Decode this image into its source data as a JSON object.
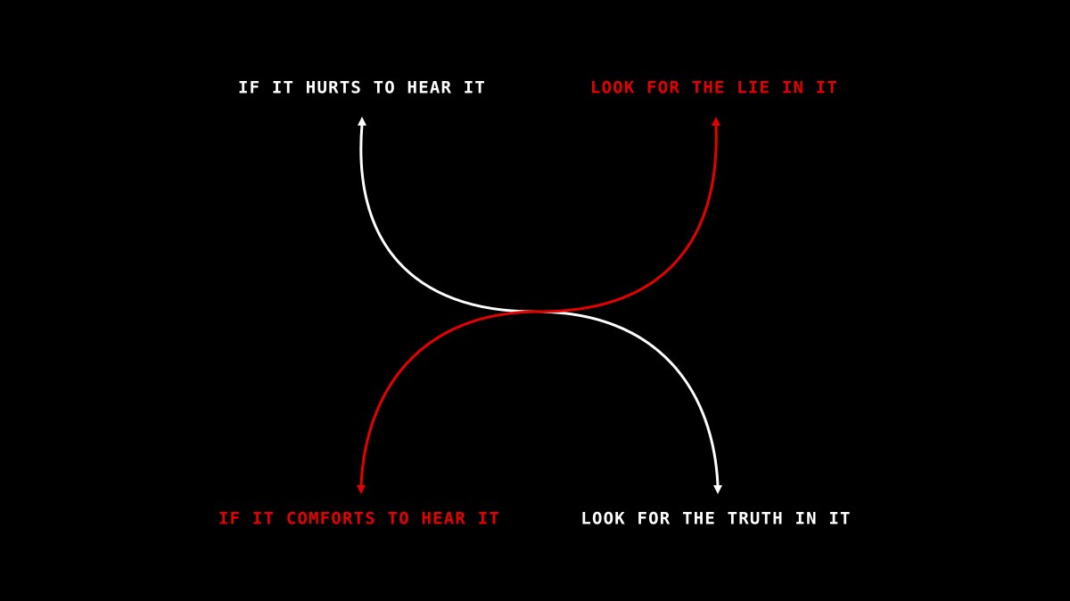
{
  "labels": {
    "top_left": "IF IT HURTS TO HEAR IT",
    "top_right": "LOOK FOR THE LIE IN IT",
    "bottom_left": "IF IT COMFORTS TO HEAR IT",
    "bottom_right": "LOOK FOR THE TRUTH IN IT"
  },
  "colors": {
    "background": "#000000",
    "white": "#ffffff",
    "red": "#e60000"
  }
}
